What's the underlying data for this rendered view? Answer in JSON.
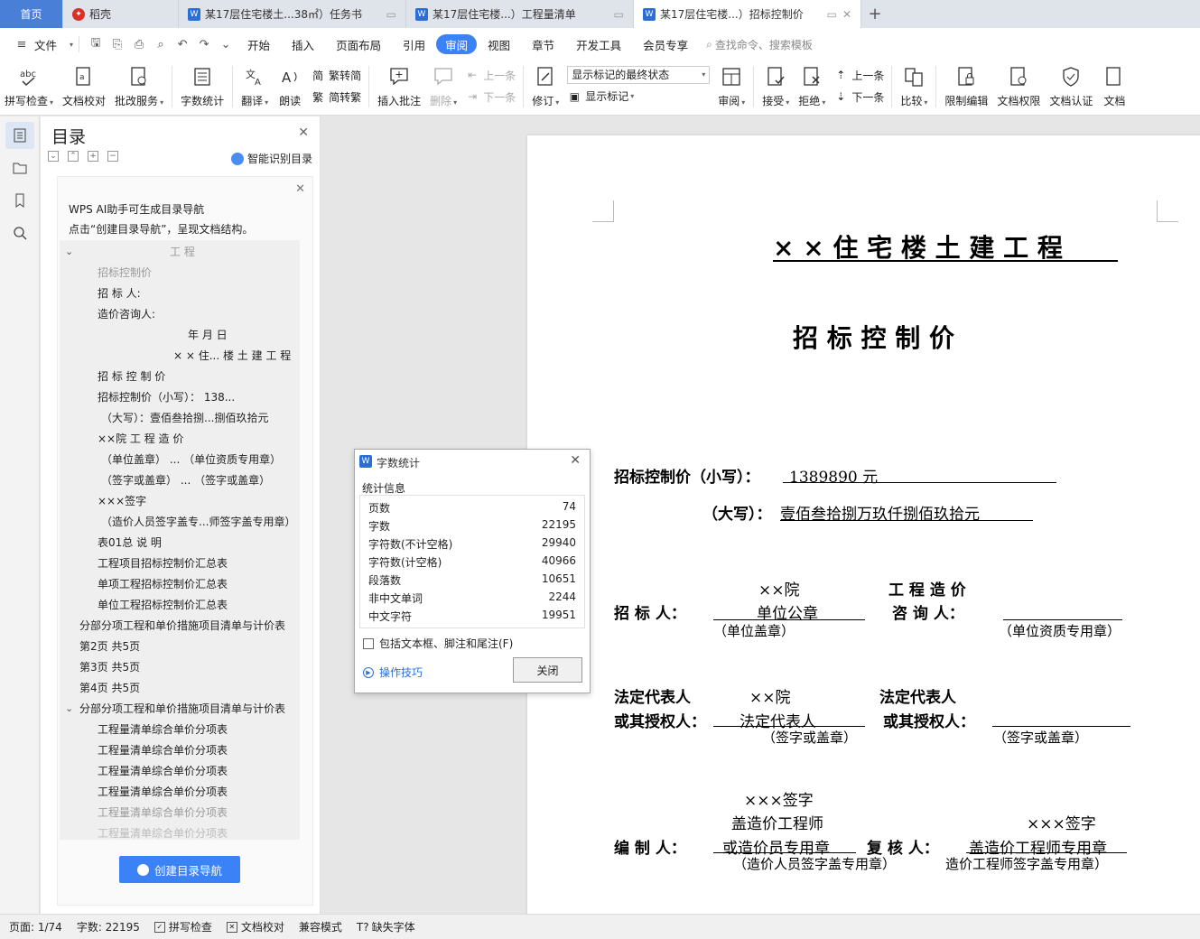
{
  "tabs": [
    {
      "label": "首页"
    },
    {
      "label": "稻壳"
    },
    {
      "label": "某17层住宅楼土...38㎡）任务书"
    },
    {
      "label": "某17层住宅楼...）工程量清单"
    },
    {
      "label": "某17层住宅楼...）招标控制价"
    }
  ],
  "menu": {
    "file": "文件",
    "items": [
      "开始",
      "插入",
      "页面布局",
      "引用",
      "审阅",
      "视图",
      "章节",
      "开发工具",
      "会员专享"
    ],
    "active": "审阅",
    "search": "查找命令、搜索模板"
  },
  "ribbon": {
    "spell": "拼写检查",
    "proof": "文档校对",
    "batch": "批改服务",
    "wordcount": "字数统计",
    "translate": "翻译",
    "read": "朗读",
    "trad": "繁转简",
    "simp": "简转繁",
    "insert_comment": "插入批注",
    "delete": "删除",
    "prev": "上一条",
    "next": "下一条",
    "revise": "修订",
    "markup_state": "显示标记的最终状态",
    "show_markup": "显示标记",
    "review": "审阅",
    "accept": "接受",
    "reject": "拒绝",
    "prev2": "上一条",
    "next2": "下一条",
    "compare": "比较",
    "restrict": "限制编辑",
    "perm": "文档权限",
    "cert": "文档认证",
    "more": "文档"
  },
  "toc": {
    "title": "目录",
    "smart": "智能识别目录",
    "ai_line1": "WPS AI助手可生成目录导航",
    "ai_line2": "点击“创建目录导航”，呈现文档结构。",
    "items": [
      "工 程",
      "招标控制价",
      "招  标  人:",
      "造价咨询人:",
      "年      月      日",
      "× × 住... 楼 土 建 工 程",
      "招 标 控 制 价",
      "招标控制价（小写）：  138...",
      "（大写）：壹佰叁拾捌...捌佰玖拾元",
      "××院          工 程 造 价",
      "（单位盖章）        ...  （单位资质专用章）",
      "（签字或盖章）       ...      （签字或盖章）",
      "×××签字",
      "（造价人员签字盖专...师签字盖专用章）",
      "表01总   说   明",
      "工程项目招标控制价汇总表",
      "单项工程招标控制价汇总表",
      "单位工程招标控制价汇总表",
      "分部分项工程和单价措施项目清单与计价表",
      "第2页 共5页",
      "第3页 共5页",
      "第4页 共5页",
      "分部分项工程和单价措施项目清单与计价表",
      "工程量清单综合单价分项表",
      "工程量清单综合单价分项表",
      "工程量清单综合单价分项表",
      "工程量清单综合单价分项表",
      "工程量清单综合单价分项表",
      "工程量清单综合单价分项表"
    ],
    "create_btn": "创建目录导航"
  },
  "doc": {
    "project": "× × 住 宅 楼 土 建 工 程",
    "title": "招 标 控 制 价",
    "small_label": "招标控制价（小写）：",
    "small_value": "1389890 元",
    "big_label": "（大写）：",
    "big_value": "壹佰叁拾捌万玖仟捌佰玖拾元",
    "tender_label": "招    标    人：",
    "tender_top": "××院",
    "tender_value": "单位公章",
    "tender_note": "（单位盖章）",
    "consult_top": "工 程 造 价",
    "consult_label": "咨    询    人：",
    "consult_note": "（单位资质专用章）",
    "legal1_l1": "法定代表人",
    "legal1_l2": "或其授权人：",
    "legal1_top": "××院",
    "legal1_value": "法定代表人",
    "legal1_note": "（签字或盖章）",
    "legal2_l1": "法定代表人",
    "legal2_l2": "或其授权人：",
    "legal2_note": "（签字或盖章）",
    "comp_top1": "×××签字",
    "comp_top2": "盖造价工程师",
    "comp_label": "编    制    人：",
    "comp_value": "或造价员专用章",
    "comp_note": "（造价人员签字盖专用章）",
    "rev_label": "复    核    人：",
    "rev_top": "×××签字",
    "rev_value": "盖造价工程师专用章",
    "rev_note": "造价工程师签字盖专用章）"
  },
  "dialog": {
    "title": "字数统计",
    "section": "统计信息",
    "stats": [
      {
        "label": "页数",
        "value": "74"
      },
      {
        "label": "字数",
        "value": "22195"
      },
      {
        "label": "字符数(不计空格)",
        "value": "29940"
      },
      {
        "label": "字符数(计空格)",
        "value": "40966"
      },
      {
        "label": "段落数",
        "value": "10651"
      },
      {
        "label": "非中文单词",
        "value": "2244"
      },
      {
        "label": "中文字符",
        "value": "19951"
      }
    ],
    "checkbox": "包括文本框、脚注和尾注(F)",
    "tips": "操作技巧",
    "close": "关闭"
  },
  "status": {
    "page": "页面: 1/74",
    "words": "字数: 22195",
    "spell": "拼写检查",
    "proof": "文档校对",
    "compat": "兼容模式",
    "font": "缺失字体"
  }
}
